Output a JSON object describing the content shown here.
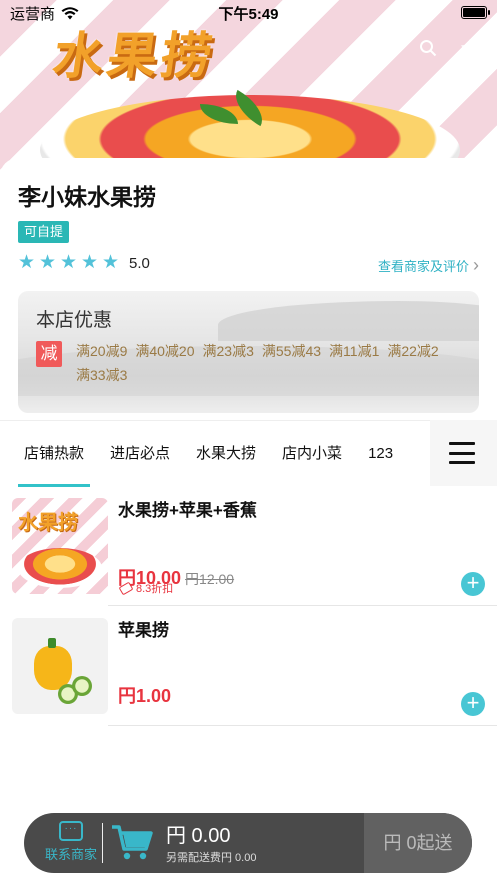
{
  "status_bar": {
    "carrier": "运营商",
    "time": "下午5:49"
  },
  "banner": {
    "title": "水果捞"
  },
  "store": {
    "name": "李小妹水果捞",
    "pickup_tag": "可自提",
    "rating": "5.0",
    "stars": 5,
    "view_merchant": "查看商家及评价"
  },
  "promotions": {
    "title": "本店优惠",
    "badge": "减",
    "items": [
      "满20减9",
      "满40减20",
      "满23减3",
      "满55减43",
      "满11减1",
      "满22减2",
      "满33减3"
    ]
  },
  "tabs": [
    {
      "label": "店铺热款",
      "active": true
    },
    {
      "label": "进店必点",
      "active": false
    },
    {
      "label": "水果大捞",
      "active": false
    },
    {
      "label": "店内小菜",
      "active": false
    },
    {
      "label": "123",
      "active": false
    }
  ],
  "products": [
    {
      "name": "水果捞+苹果+香蕉",
      "price": "円10.00",
      "original_price": "円12.00",
      "discount": "8.3折扣",
      "thumb_text": "水果捞"
    },
    {
      "name": "苹果捞",
      "price": "円1.00"
    }
  ],
  "cart": {
    "contact_label": "联系商家",
    "total": "円 0.00",
    "delivery_fee": "另需配送费円 0.00",
    "min_order": "円 0起送"
  },
  "colors": {
    "accent": "#32c2c9",
    "price_red": "#e8343f",
    "cart_bg": "#4a4a4a"
  }
}
